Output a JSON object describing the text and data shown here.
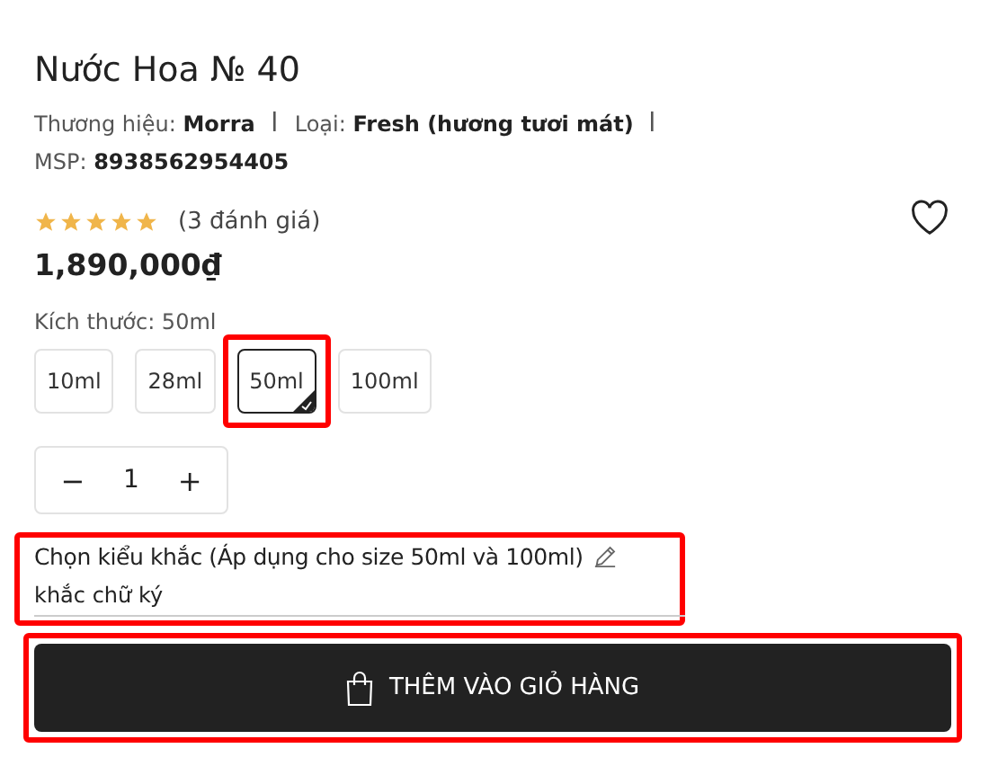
{
  "product": {
    "title": "Nước Hoa № 40",
    "meta": [
      {
        "label": "Thương hiệu:",
        "value": "Morra"
      },
      {
        "label": "Loại:",
        "value": "Fresh (hương tươi mát)"
      },
      {
        "label": "MSP:",
        "value": "8938562954405"
      }
    ],
    "stars": 5,
    "reviews": "(3 đánh giá)",
    "favorite": false,
    "price": "1,890,000₫"
  },
  "size": {
    "label": "Kích thước: 50ml",
    "highlighted": true,
    "options": [
      {
        "label": "10ml",
        "selected": false
      },
      {
        "label": "28ml",
        "selected": false
      },
      {
        "label": "50ml",
        "selected": true
      },
      {
        "label": "100ml",
        "selected": false
      }
    ]
  },
  "quantity": {
    "minus": "−",
    "value": "1",
    "plus": "+"
  },
  "engraving": {
    "label": "Chọn kiểu khắc (Áp dụng cho size 50ml và 100ml)",
    "value": "khắc chữ ký",
    "highlighted": true
  },
  "add_to_cart": {
    "label": "THÊM VÀO GIỎ HÀNG",
    "highlighted": true
  }
}
